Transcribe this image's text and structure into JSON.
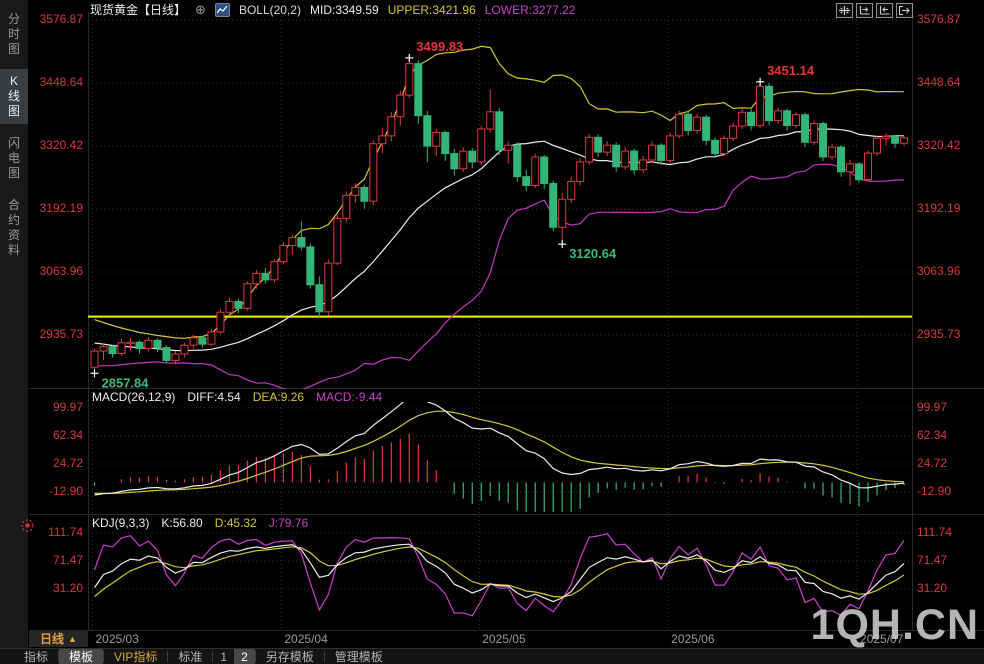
{
  "header": {
    "title": "现货黄金",
    "period": "【日线】",
    "boll_label": "BOLL(20,2)",
    "mid": "MID:3349.59",
    "upper": "UPPER:3421.96",
    "lower": "LOWER:3277.22"
  },
  "sidebar": {
    "tabs": [
      {
        "label": "分时图",
        "name": "tab-timeshare-chart",
        "active": false
      },
      {
        "label": "K线图",
        "name": "tab-kline-chart",
        "active": true
      },
      {
        "label": "闪电图",
        "name": "tab-lightning-chart",
        "active": false
      },
      {
        "label": "合约资料",
        "name": "tab-contract-info",
        "active": false
      }
    ]
  },
  "top_buttons": [
    {
      "name": "crosshair-button",
      "icon": "crosshair-icon"
    },
    {
      "name": "axis-scale-left-button",
      "icon": "axis-left-icon"
    },
    {
      "name": "axis-scale-right-button",
      "icon": "axis-right-icon"
    },
    {
      "name": "detach-window-button",
      "icon": "detach-icon"
    }
  ],
  "main_axis": {
    "ticks": [
      3576.87,
      3448.64,
      3320.42,
      3192.19,
      3063.96,
      2935.73
    ]
  },
  "macd_panel": {
    "label": "MACD(26,12,9)",
    "diff_label": "DIFF:4.54",
    "dea_label": "DEA:9.26",
    "macd_label": "MACD:-9.44",
    "ticks": [
      99.97,
      62.34,
      24.72,
      -12.9
    ]
  },
  "kdj_panel": {
    "label": "KDJ(9,3,3)",
    "k_label": "K:56.80",
    "d_label": "D:45.32",
    "j_label": "J:79.76",
    "ticks": [
      111.74,
      71.47,
      31.2
    ]
  },
  "x_axis": {
    "period_label": "日线",
    "period_arrow": "▲"
  },
  "bottom_bar": {
    "items": [
      {
        "label": "指标",
        "name": "toolbar-indicators",
        "sep_after": true
      },
      {
        "label": "模板",
        "name": "toolbar-templates",
        "active": true,
        "sep_after": true
      },
      {
        "label": "VIP指标",
        "name": "toolbar-vip-indicators",
        "vip": true,
        "sep_after": true
      },
      {
        "label": "标准",
        "name": "toolbar-standard",
        "sep_after": true
      },
      {
        "label": "1",
        "name": "toolbar-page-1",
        "page": true
      },
      {
        "label": "2",
        "name": "toolbar-page-2",
        "page": true,
        "active": true,
        "sep_after": true
      },
      {
        "label": "另存模板",
        "name": "toolbar-save-as-template",
        "sep_after": true
      },
      {
        "label": "管理模板",
        "name": "toolbar-manage-template"
      }
    ]
  },
  "watermark": "1QH.CN",
  "icons": {
    "circle_plus": "⊕",
    "mini_chart": "mini-chart-icon",
    "alarm": "alarm-dot-icon"
  },
  "colors": {
    "up": "#e0383e",
    "down": "#33b577",
    "boll_mid": "#ececec",
    "boll_upper": "#d6c531",
    "boll_lower": "#c136c1",
    "axis_text": "#d7373d",
    "month_text": "#9a9a9a",
    "grid": "#2f2f34",
    "border": "#2a2a2a",
    "alert_line": "#f5f500",
    "ann_high": "#e8333c",
    "ann_low": "#3cb878",
    "diff": "#ececec",
    "dea": "#d6c531",
    "jline": "#cc3ccc"
  },
  "chart_data": {
    "type": "candlestick+indicators",
    "symbol": "现货黄金",
    "period": "日线",
    "boll_params": [
      20,
      2
    ],
    "macd_params": [
      26,
      12,
      9
    ],
    "kdj_params": [
      9,
      3,
      3
    ],
    "alert_line_price": 2973,
    "months": [
      {
        "label": "2025/03",
        "index": 0
      },
      {
        "label": "2025/04",
        "index": 21
      },
      {
        "label": "2025/05",
        "index": 43
      },
      {
        "label": "2025/06",
        "index": 64
      },
      {
        "label": "2025/07",
        "index": 85
      }
    ],
    "annotations": [
      {
        "text": "3499.83",
        "index": 35,
        "price": 3499.83,
        "type": "high"
      },
      {
        "text": "3451.14",
        "index": 74,
        "price": 3451.14,
        "type": "high"
      },
      {
        "text": "3120.64",
        "index": 52,
        "price": 3120.64,
        "type": "low"
      },
      {
        "text": "2857.84",
        "index": 0,
        "price": 2857.84,
        "type": "low"
      }
    ],
    "candles": [
      [
        2870,
        2908,
        2857.84,
        2903
      ],
      [
        2903,
        2918,
        2885,
        2912
      ],
      [
        2912,
        2916,
        2890,
        2898
      ],
      [
        2898,
        2928,
        2893,
        2920
      ],
      [
        2920,
        2930,
        2905,
        2921
      ],
      [
        2921,
        2925,
        2898,
        2908
      ],
      [
        2908,
        2932,
        2902,
        2925
      ],
      [
        2925,
        2929,
        2901,
        2910
      ],
      [
        2910,
        2914,
        2878,
        2884
      ],
      [
        2884,
        2903,
        2876,
        2897
      ],
      [
        2897,
        2920,
        2890,
        2915
      ],
      [
        2915,
        2936,
        2908,
        2930
      ],
      [
        2930,
        2934,
        2910,
        2917
      ],
      [
        2917,
        2948,
        2913,
        2942
      ],
      [
        2942,
        2988,
        2938,
        2982
      ],
      [
        2982,
        3012,
        2974,
        3004
      ],
      [
        3004,
        3010,
        2980,
        2990
      ],
      [
        2990,
        3045,
        2985,
        3040
      ],
      [
        3040,
        3068,
        3030,
        3061
      ],
      [
        3061,
        3072,
        3040,
        3048
      ],
      [
        3048,
        3090,
        3042,
        3085
      ],
      [
        3085,
        3125,
        3080,
        3118
      ],
      [
        3118,
        3140,
        3100,
        3134
      ],
      [
        3134,
        3167,
        3108,
        3115
      ],
      [
        3115,
        3122,
        3030,
        3038
      ],
      [
        3038,
        3055,
        2970,
        2983
      ],
      [
        2983,
        3090,
        2975,
        3082
      ],
      [
        3082,
        3180,
        3078,
        3173
      ],
      [
        3173,
        3228,
        3165,
        3220
      ],
      [
        3220,
        3245,
        3205,
        3236
      ],
      [
        3236,
        3242,
        3193,
        3208
      ],
      [
        3208,
        3332,
        3200,
        3325
      ],
      [
        3325,
        3358,
        3305,
        3341
      ],
      [
        3341,
        3390,
        3330,
        3380
      ],
      [
        3380,
        3433,
        3362,
        3424
      ],
      [
        3424,
        3499.83,
        3418,
        3488
      ],
      [
        3488,
        3495,
        3365,
        3382
      ],
      [
        3382,
        3392,
        3288,
        3320
      ],
      [
        3320,
        3355,
        3300,
        3348
      ],
      [
        3348,
        3352,
        3290,
        3305
      ],
      [
        3305,
        3315,
        3260,
        3274
      ],
      [
        3274,
        3318,
        3268,
        3310
      ],
      [
        3310,
        3316,
        3275,
        3288
      ],
      [
        3288,
        3362,
        3282,
        3355
      ],
      [
        3355,
        3435,
        3348,
        3390
      ],
      [
        3390,
        3398,
        3302,
        3312
      ],
      [
        3312,
        3330,
        3285,
        3322
      ],
      [
        3322,
        3328,
        3248,
        3258
      ],
      [
        3258,
        3272,
        3228,
        3240
      ],
      [
        3240,
        3305,
        3235,
        3298
      ],
      [
        3298,
        3302,
        3232,
        3244
      ],
      [
        3244,
        3250,
        3148,
        3155
      ],
      [
        3155,
        3225,
        3120.64,
        3212
      ],
      [
        3212,
        3258,
        3205,
        3248
      ],
      [
        3248,
        3295,
        3240,
        3288
      ],
      [
        3288,
        3345,
        3282,
        3338
      ],
      [
        3338,
        3344,
        3298,
        3308
      ],
      [
        3308,
        3330,
        3300,
        3322
      ],
      [
        3322,
        3328,
        3268,
        3278
      ],
      [
        3278,
        3318,
        3272,
        3310
      ],
      [
        3310,
        3315,
        3262,
        3272
      ],
      [
        3272,
        3300,
        3265,
        3292
      ],
      [
        3292,
        3330,
        3286,
        3322
      ],
      [
        3322,
        3326,
        3282,
        3291
      ],
      [
        3291,
        3348,
        3285,
        3341
      ],
      [
        3341,
        3392,
        3336,
        3385
      ],
      [
        3385,
        3390,
        3342,
        3352
      ],
      [
        3352,
        3386,
        3346,
        3379
      ],
      [
        3379,
        3384,
        3322,
        3332
      ],
      [
        3332,
        3338,
        3296,
        3305
      ],
      [
        3305,
        3342,
        3300,
        3336
      ],
      [
        3336,
        3368,
        3330,
        3361
      ],
      [
        3361,
        3396,
        3355,
        3389
      ],
      [
        3389,
        3398,
        3352,
        3362
      ],
      [
        3362,
        3451.14,
        3356,
        3442
      ],
      [
        3442,
        3448,
        3362,
        3372
      ],
      [
        3372,
        3398,
        3366,
        3392
      ],
      [
        3392,
        3396,
        3352,
        3362
      ],
      [
        3362,
        3390,
        3356,
        3384
      ],
      [
        3384,
        3388,
        3318,
        3328
      ],
      [
        3328,
        3372,
        3322,
        3366
      ],
      [
        3366,
        3370,
        3290,
        3298
      ],
      [
        3298,
        3325,
        3292,
        3318
      ],
      [
        3318,
        3322,
        3258,
        3268
      ],
      [
        3268,
        3292,
        3240,
        3284
      ],
      [
        3284,
        3288,
        3246,
        3252
      ],
      [
        3252,
        3312,
        3248,
        3306
      ],
      [
        3306,
        3342,
        3300,
        3336
      ],
      [
        3336,
        3346,
        3322,
        3340
      ],
      [
        3340,
        3343,
        3316,
        3326
      ],
      [
        3326,
        3341,
        3320,
        3337
      ]
    ]
  }
}
